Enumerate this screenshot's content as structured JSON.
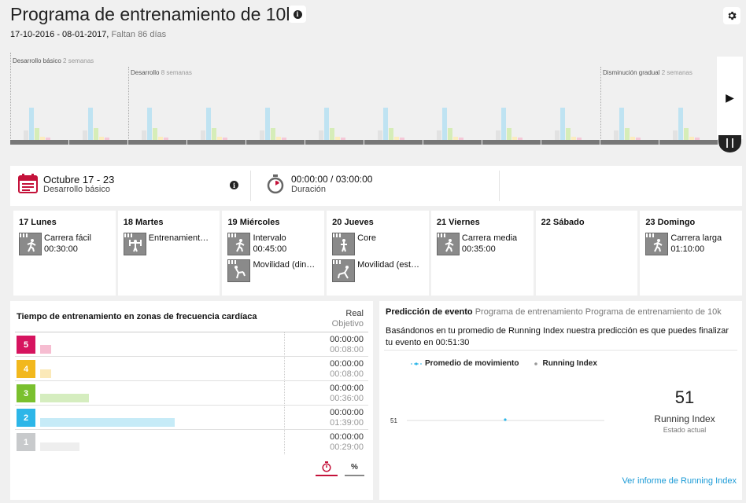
{
  "header": {
    "title": "Programa de entrenamiento de 10k",
    "dates": "17-10-2016 - 08-01-2017,",
    "remaining": "Faltan 86 días"
  },
  "timeline": {
    "phases": [
      {
        "name": "Desarrollo básico",
        "duration": "2 semanas"
      },
      {
        "name": "Desarrollo",
        "duration": "8 semanas"
      },
      {
        "name": "Disminución gradual",
        "duration": "2 semanas"
      }
    ],
    "bar_colors": [
      "#e2e2e2",
      "#bfe3f2",
      "#d6edb8",
      "#fbedbf",
      "#f5c8d7"
    ],
    "weeks": [
      [
        18,
        60,
        22,
        6,
        4
      ],
      [
        18,
        60,
        22,
        6,
        4
      ],
      [
        18,
        60,
        22,
        6,
        4
      ],
      [
        18,
        60,
        22,
        6,
        4
      ],
      [
        18,
        60,
        22,
        6,
        4
      ],
      [
        18,
        60,
        22,
        6,
        4
      ],
      [
        18,
        60,
        22,
        6,
        4
      ],
      [
        18,
        60,
        22,
        6,
        4
      ],
      [
        18,
        60,
        22,
        6,
        4
      ],
      [
        18,
        60,
        22,
        6,
        4
      ],
      [
        18,
        60,
        22,
        6,
        4
      ],
      [
        18,
        60,
        22,
        6,
        4
      ]
    ]
  },
  "week_summary": {
    "range": "Octubre 17 - 23",
    "phase": "Desarrollo básico",
    "duration": "00:00:00 / 03:00:00",
    "duration_label": "Duración"
  },
  "days": [
    {
      "name": "17 Lunes",
      "sessions": [
        {
          "icon": "running-icon",
          "label": "Carrera fácil",
          "time": "00:30:00"
        }
      ]
    },
    {
      "name": "18 Martes",
      "sessions": [
        {
          "icon": "strength-icon",
          "label": "Entrenamient…",
          "time": ""
        }
      ]
    },
    {
      "name": "19 Miércoles",
      "sessions": [
        {
          "icon": "running-icon",
          "label": "Intervalo",
          "time": "00:45:00"
        },
        {
          "icon": "mobility-icon",
          "label": "Movilidad (din…",
          "time": ""
        }
      ]
    },
    {
      "name": "20 Jueves",
      "sessions": [
        {
          "icon": "core-icon",
          "label": "Core",
          "time": ""
        },
        {
          "icon": "stretch-icon",
          "label": "Movilidad (est…",
          "time": ""
        }
      ]
    },
    {
      "name": "21 Viernes",
      "sessions": [
        {
          "icon": "running-icon",
          "label": "Carrera media",
          "time": "00:35:00"
        }
      ]
    },
    {
      "name": "22 Sábado",
      "sessions": []
    },
    {
      "name": "23 Domingo",
      "sessions": [
        {
          "icon": "running-icon",
          "label": "Carrera larga",
          "time": "01:10:00"
        }
      ]
    }
  ],
  "zones": {
    "title": "Tiempo de entrenamiento en zonas de frecuencia cardíaca",
    "col_real": "Real",
    "col_target": "Objetivo",
    "rows": [
      {
        "zone": "5",
        "color": "#d6145f",
        "bar_color": "#f6bdd1",
        "target_fraction": 0.08,
        "real": "00:00:00",
        "target": "00:08:00"
      },
      {
        "zone": "4",
        "color": "#f2b81d",
        "bar_color": "#fbe9b8",
        "target_fraction": 0.08,
        "real": "00:00:00",
        "target": "00:08:00"
      },
      {
        "zone": "3",
        "color": "#7ac02e",
        "bar_color": "#d5edbf",
        "target_fraction": 0.36,
        "real": "00:00:00",
        "target": "00:36:00"
      },
      {
        "zone": "2",
        "color": "#2db6e8",
        "bar_color": "#c6ebf7",
        "target_fraction": 1.0,
        "real": "00:00:00",
        "target": "01:39:00"
      },
      {
        "zone": "1",
        "color": "#c8cacc",
        "bar_color": "#eeeeee",
        "target_fraction": 0.29,
        "real": "00:00:00",
        "target": "00:29:00"
      }
    ],
    "toggle_pct": "%"
  },
  "prediction": {
    "title": "Predicción de evento",
    "subtitle": "Programa de entrenamiento Programa de entrenamiento de 10k",
    "text": "Basándonos en tu promedio de Running Index nuestra predicción es que puedes finalizar tu evento en 00:51:30",
    "legend_avg": "Promedio de movimiento",
    "legend_ri": "Running Index",
    "chart_y_label": "51",
    "ri_value": "51",
    "ri_label": "Running Index",
    "ri_sub": "Estado actual",
    "link": "Ver informe de Running Index"
  }
}
